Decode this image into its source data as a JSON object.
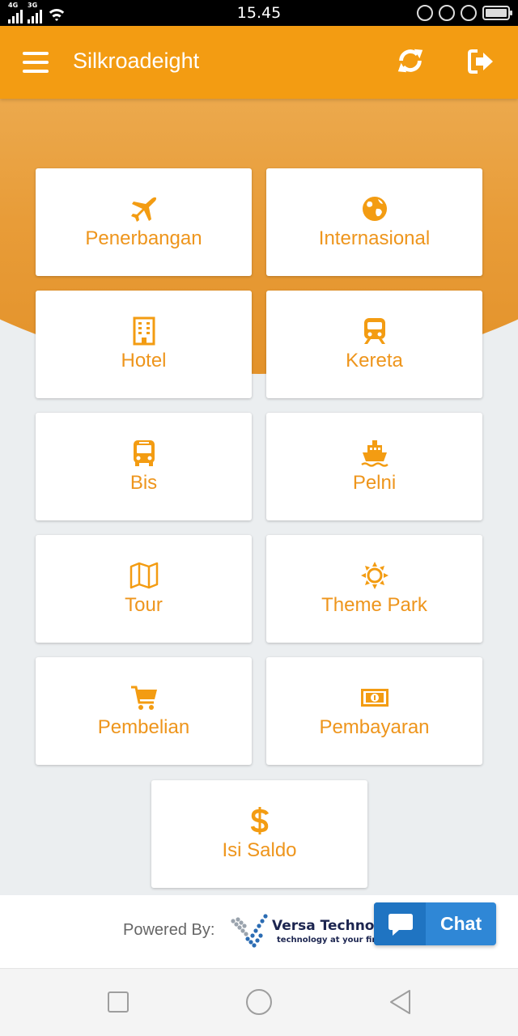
{
  "status_bar": {
    "time": "15.45",
    "net1": "4G",
    "net2": "3G"
  },
  "app_bar": {
    "title": "Silkroadeight",
    "menu_icon": "hamburger-menu-icon",
    "refresh_icon": "refresh-icon",
    "logout_icon": "logout-icon"
  },
  "menu": {
    "items": [
      {
        "label": "Penerbangan",
        "icon": "airplane-icon"
      },
      {
        "label": "Internasional",
        "icon": "globe-icon"
      },
      {
        "label": "Hotel",
        "icon": "building-icon"
      },
      {
        "label": "Kereta",
        "icon": "train-icon"
      },
      {
        "label": "Bis",
        "icon": "bus-icon"
      },
      {
        "label": "Pelni",
        "icon": "ship-icon"
      },
      {
        "label": "Tour",
        "icon": "map-icon"
      },
      {
        "label": "Theme Park",
        "icon": "sun-icon"
      },
      {
        "label": "Pembelian",
        "icon": "cart-icon"
      },
      {
        "label": "Pembayaran",
        "icon": "money-icon"
      },
      {
        "label": "Isi Saldo",
        "icon": "dollar-icon"
      }
    ]
  },
  "footer": {
    "powered_by": "Powered By:",
    "logo_name": "Versa Technolo",
    "logo_tagline": "technology at your fingert",
    "chat_label": "Chat"
  },
  "colors": {
    "accent": "#f39c12",
    "label": "#ee951c",
    "chat": "#2f87d6"
  }
}
